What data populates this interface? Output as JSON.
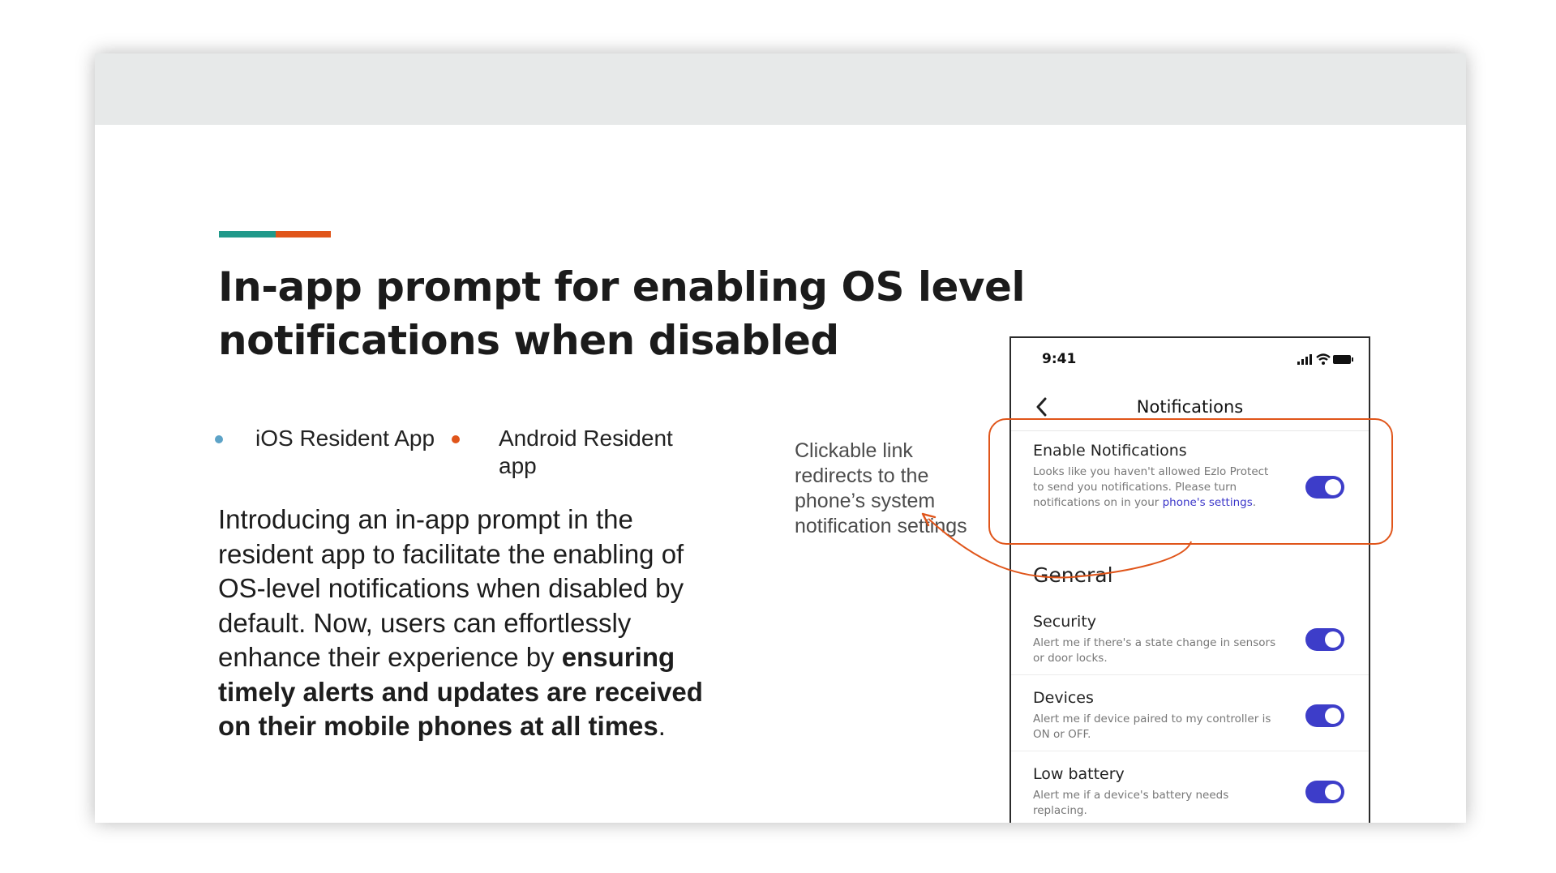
{
  "slide": {
    "title": "In-app prompt for enabling OS level notifications when disabled",
    "accent_colors": [
      "#20998a",
      "#e0551a"
    ],
    "bullets": [
      {
        "label": "iOS Resident App",
        "dot_color": "#5da3c7"
      },
      {
        "label": "Android Resident app",
        "dot_color": "#e0551a"
      }
    ],
    "body": {
      "intro": "Introducing an in-app prompt in the resident app to facilitate the enabling of OS-level notifications when disabled by default. Now, users can effortlessly enhance their experience by ",
      "emphasis": "ensuring timely alerts and updates are received on their mobile phones at all times",
      "end": "."
    },
    "callout": "Clickable link redirects to the phone’s system notification settings",
    "highlight_color": "#e0551a"
  },
  "phone": {
    "status_time": "9:41",
    "status_icons": [
      "signal-icon",
      "wifi-icon",
      "battery-icon"
    ],
    "nav_title": "Notifications",
    "enable": {
      "title": "Enable Notifications",
      "desc_prefix": "Looks like you haven't allowed Ezlo Protect to send you notifications. Please turn notifications on in your ",
      "link": "phone's settings",
      "desc_suffix": ".",
      "enabled": true
    },
    "section_heading": "General",
    "settings": [
      {
        "title": "Security",
        "desc": "Alert me if there's a state change in sensors or door locks.",
        "enabled": true
      },
      {
        "title": "Devices",
        "desc": "Alert me if device paired to my controller is ON or OFF.",
        "enabled": true
      },
      {
        "title": "Low battery",
        "desc": "Alert me if a device's battery needs replacing.",
        "enabled": true
      }
    ],
    "toggle_color": "#3d3dc9"
  }
}
